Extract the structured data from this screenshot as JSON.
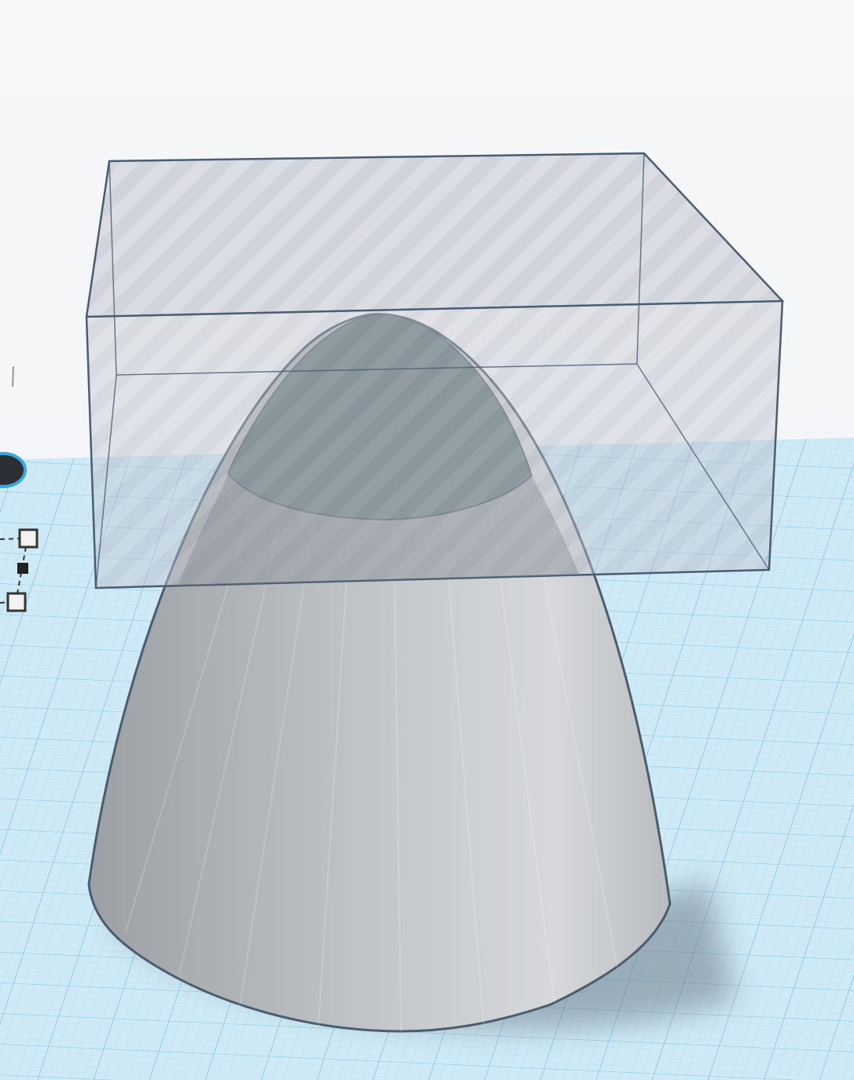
{
  "app": {
    "name": "",
    "view": "3d-workplane"
  },
  "scene": {
    "workplane": {
      "color": "#bfe3f3",
      "grid_line_color": "#8fcbe6"
    },
    "objects": [
      {
        "name": "paraboloid",
        "kind": "solid",
        "color": "#c4c8cc",
        "cutaway_color": "#5f7378"
      },
      {
        "name": "box",
        "kind": "hole",
        "color": "#b9bdc6",
        "edge_color": "#4a5d74"
      }
    ],
    "selection": {
      "handles": [
        "handle-top",
        "handle-mid",
        "handle-bottom"
      ],
      "rotate_handle": {
        "color": "#2b2f33",
        "ring_color": "#39a7e0"
      }
    }
  }
}
